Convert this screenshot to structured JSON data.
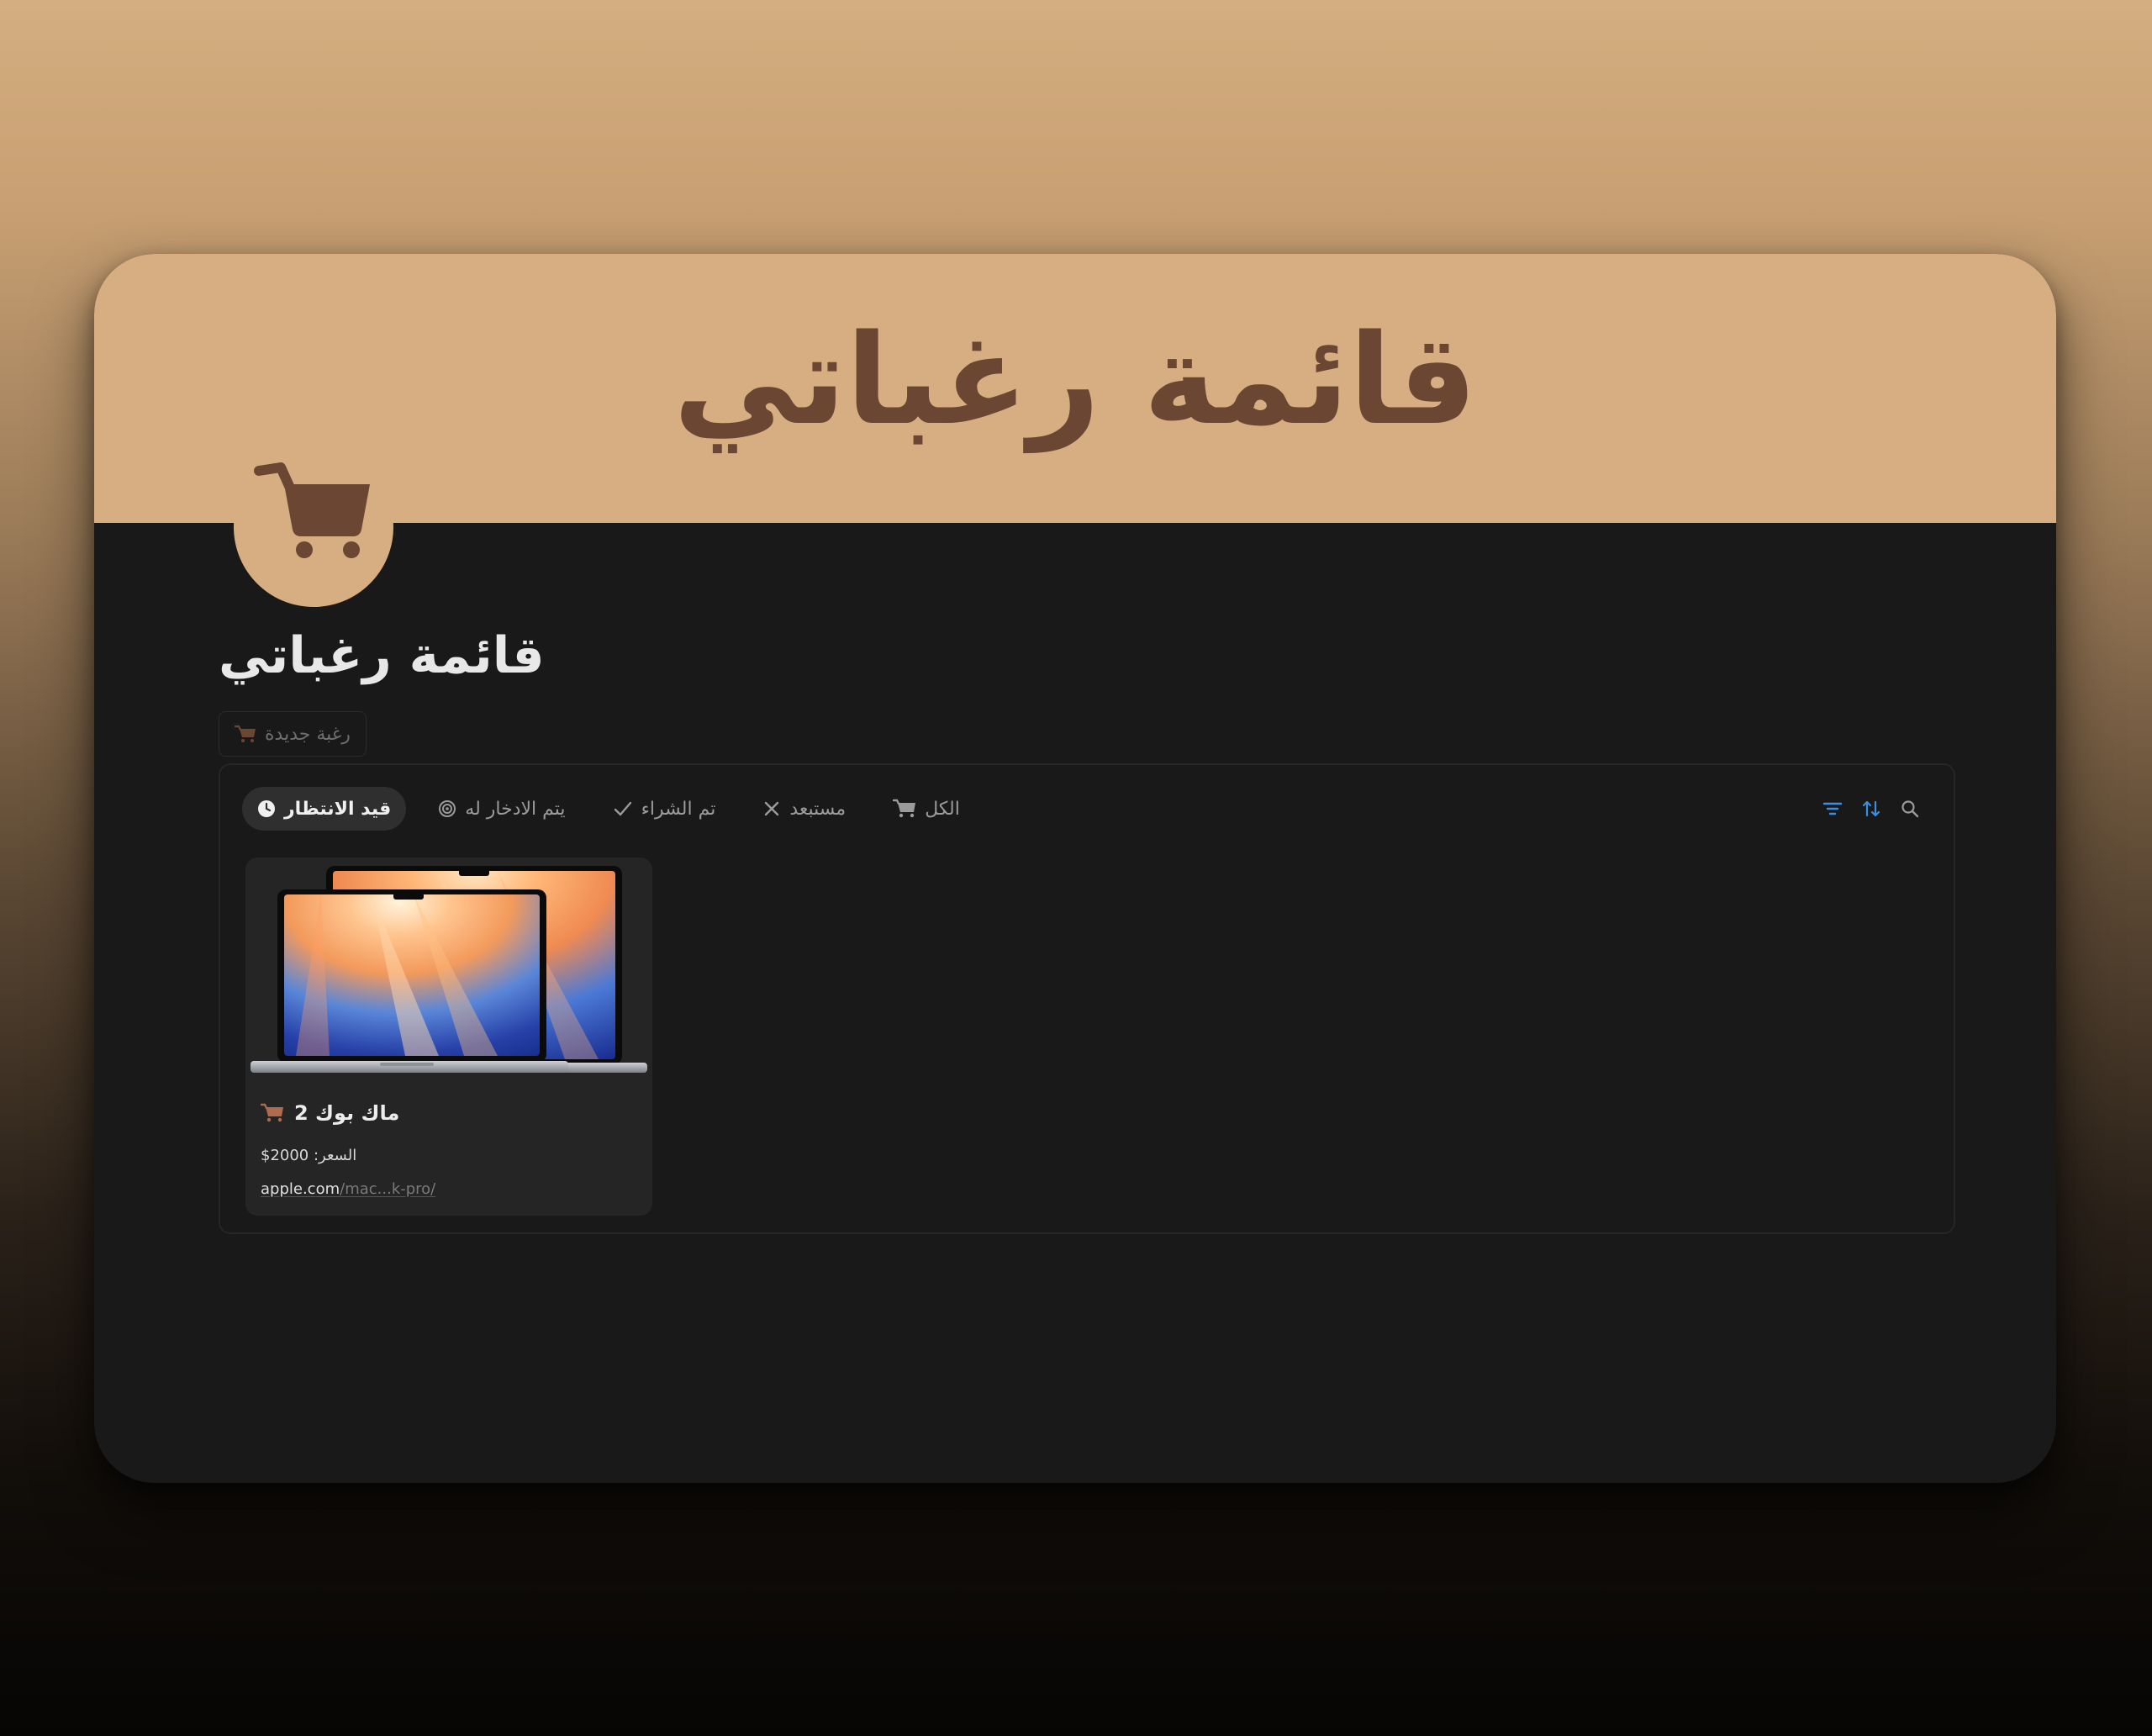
{
  "cover": {
    "title": "قائمة رغباتي",
    "color": "#d6ae82",
    "text_color": "#6b4633",
    "icon": "shopping-cart-icon"
  },
  "page": {
    "title": "قائمة رغباتي"
  },
  "toolbar": {
    "new_label": "رغبة جديدة",
    "new_icon": "shopping-cart-icon"
  },
  "database": {
    "tabs": [
      {
        "label": "قيد الانتظار",
        "icon": "clock-icon",
        "active": true
      },
      {
        "label": "يتم الادخار له",
        "icon": "target-icon",
        "active": false
      },
      {
        "label": "تم الشراء",
        "icon": "check-icon",
        "active": false
      },
      {
        "label": "مستبعد",
        "icon": "x-icon",
        "active": false
      },
      {
        "label": "الكل",
        "icon": "shopping-cart-icon",
        "active": false
      }
    ],
    "tools": [
      "filter-icon",
      "sort-icon",
      "search-icon"
    ],
    "accent": "#3b8fe0",
    "cards": [
      {
        "name": "ماك بوك 2",
        "price": "السعر: 2000$",
        "url_host": "apple.com",
        "url_path": "/mac...k-pro/",
        "image": "macbook-laptops-image"
      }
    ]
  }
}
